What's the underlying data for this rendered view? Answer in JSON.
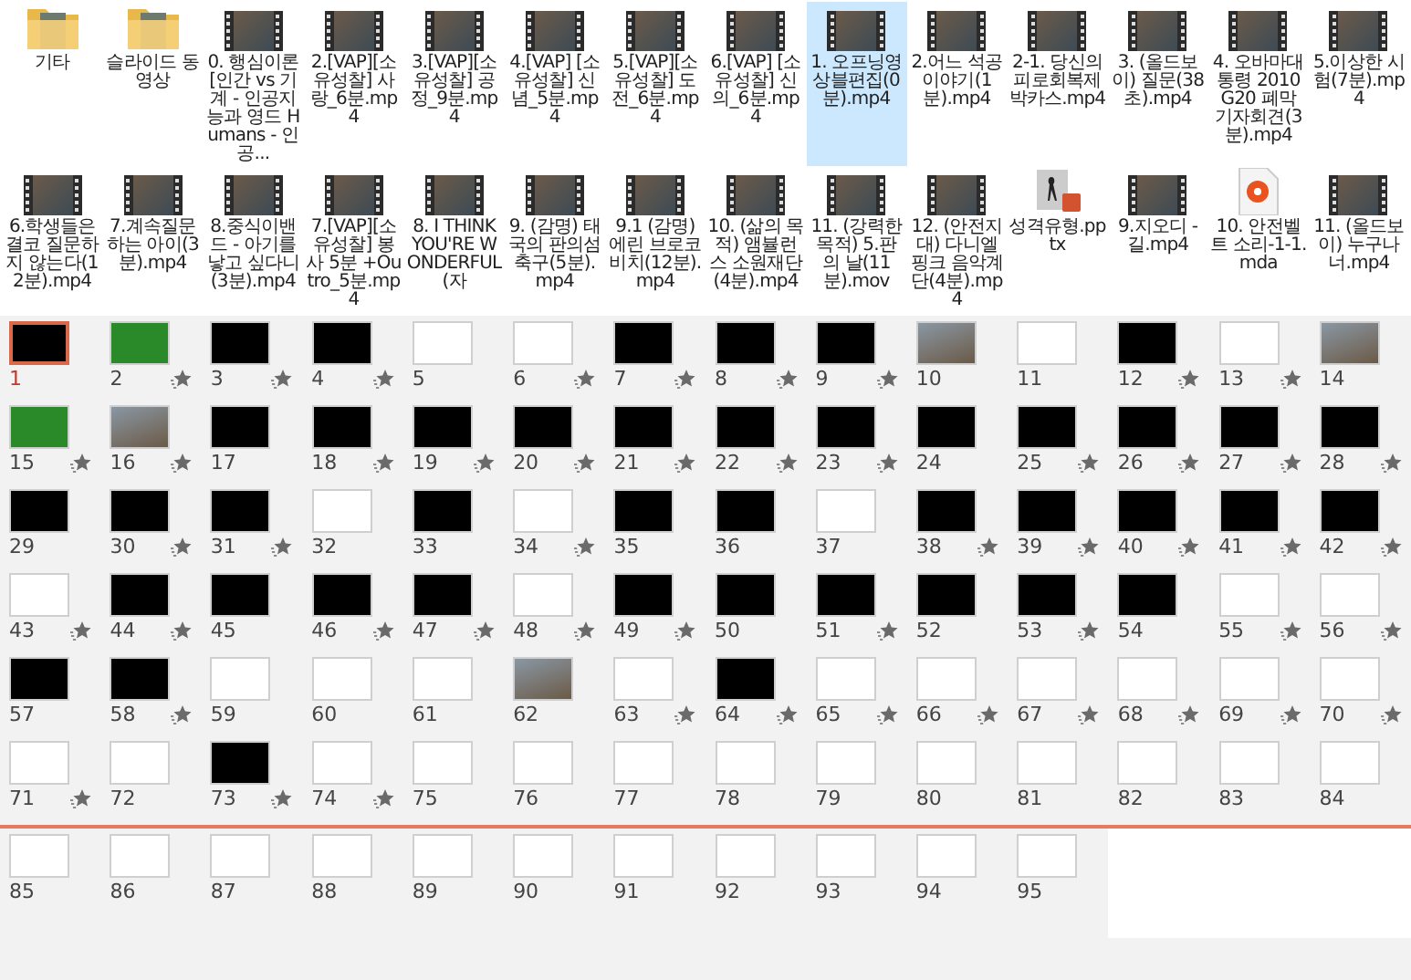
{
  "files": [
    {
      "kind": "folder",
      "label": "기타",
      "selected": false
    },
    {
      "kind": "folder",
      "label": "슬라이드 동영상",
      "selected": false
    },
    {
      "kind": "video",
      "label": "0. 행심이론 [인간 vs 기계 - 인공지능과 영드 Humans - 인공...",
      "selected": false
    },
    {
      "kind": "video",
      "label": "2.[VAP][소유성찰] 사랑_6분.mp4",
      "selected": false
    },
    {
      "kind": "video",
      "label": "3.[VAP][소유성찰] 공정_9분.mp4",
      "selected": false
    },
    {
      "kind": "video",
      "label": "4.[VAP] [소유성찰] 신념_5분.mp4",
      "selected": false
    },
    {
      "kind": "video",
      "label": "5.[VAP][소유성찰] 도전_6분.mp4",
      "selected": false
    },
    {
      "kind": "video",
      "label": "6.[VAP] [소유성찰] 신의_6분.mp4",
      "selected": false
    },
    {
      "kind": "video",
      "label": "1. 오프닝영상블편집(0분).mp4",
      "selected": true
    },
    {
      "kind": "video",
      "label": "2.어느 석공 이야기(1분).mp4",
      "selected": false
    },
    {
      "kind": "video",
      "label": "2-1. 당신의 피로회복제 박카스.mp4",
      "selected": false
    },
    {
      "kind": "video",
      "label": "3. (올드보이) 질문(38초).mp4",
      "selected": false
    },
    {
      "kind": "video",
      "label": "4. 오바마대통령 2010 G20 폐막 기자회견(3분).mp4",
      "selected": false
    },
    {
      "kind": "video",
      "label": "5.이상한 시험(7분).mp4",
      "selected": false
    },
    {
      "kind": "video",
      "label": "6.학생들은 결코 질문하지 않는다(12분).mp4",
      "selected": false
    },
    {
      "kind": "video",
      "label": "7.계속질문하는 아이(3분).mp4",
      "selected": false
    },
    {
      "kind": "video",
      "label": "8.중식이밴드 - 아기를 낳고 싶다니(3분).mp4",
      "selected": false
    },
    {
      "kind": "video",
      "label": "7.[VAP][소유성찰] 봉사 5분 +Outro_5분.mp4",
      "selected": false
    },
    {
      "kind": "video",
      "label": "8. I THINK YOU'RE WONDERFUL(자",
      "selected": false
    },
    {
      "kind": "video",
      "label": "9. (감명) 태국의 판의섬축구(5분).mp4",
      "selected": false
    },
    {
      "kind": "video",
      "label": "9.1 (감명)에린 브로코비치(12분).mp4",
      "selected": false
    },
    {
      "kind": "video",
      "label": "10. (삶의 목적) 앰뷸런스 소원재단(4분).mp4",
      "selected": false
    },
    {
      "kind": "video",
      "label": "11. (강력한 목적) 5.판의 날(11분).mov",
      "selected": false
    },
    {
      "kind": "video",
      "label": "12. (안전지대) 다니엘핑크 음악계단(4분).mp4",
      "selected": false
    },
    {
      "kind": "pptx",
      "label": "성격유형.pptx",
      "selected": false
    },
    {
      "kind": "video",
      "label": "9.지오디 - 길.mp4",
      "selected": false
    },
    {
      "kind": "audio",
      "label": "10. 안전벨트 소리-1-1.mda",
      "selected": false
    },
    {
      "kind": "video",
      "label": "11. (올드보이) 누구나 너.mp4",
      "selected": false
    }
  ],
  "slides": [
    {
      "number": "1",
      "kind": "dark",
      "animated": false,
      "selected": true
    },
    {
      "number": "2",
      "kind": "green",
      "animated": true,
      "selected": false
    },
    {
      "number": "3",
      "kind": "dark",
      "animated": true,
      "selected": false
    },
    {
      "number": "4",
      "kind": "dark",
      "animated": true,
      "selected": false
    },
    {
      "number": "5",
      "kind": "light",
      "animated": false,
      "selected": false
    },
    {
      "number": "6",
      "kind": "light",
      "animated": true,
      "selected": false
    },
    {
      "number": "7",
      "kind": "dark",
      "animated": true,
      "selected": false
    },
    {
      "number": "8",
      "kind": "dark",
      "animated": true,
      "selected": false
    },
    {
      "number": "9",
      "kind": "dark",
      "animated": true,
      "selected": false
    },
    {
      "number": "10",
      "kind": "photo",
      "animated": false,
      "selected": false
    },
    {
      "number": "11",
      "kind": "light",
      "animated": false,
      "selected": false
    },
    {
      "number": "12",
      "kind": "dark",
      "animated": true,
      "selected": false
    },
    {
      "number": "13",
      "kind": "light",
      "animated": true,
      "selected": false
    },
    {
      "number": "14",
      "kind": "photo",
      "animated": false,
      "selected": false
    },
    {
      "number": "15",
      "kind": "green",
      "animated": true,
      "selected": false
    },
    {
      "number": "16",
      "kind": "photo",
      "animated": true,
      "selected": false
    },
    {
      "number": "17",
      "kind": "dark",
      "animated": false,
      "selected": false
    },
    {
      "number": "18",
      "kind": "dark",
      "animated": true,
      "selected": false
    },
    {
      "number": "19",
      "kind": "dark",
      "animated": true,
      "selected": false
    },
    {
      "number": "20",
      "kind": "dark",
      "animated": true,
      "selected": false
    },
    {
      "number": "21",
      "kind": "dark",
      "animated": true,
      "selected": false
    },
    {
      "number": "22",
      "kind": "dark",
      "animated": true,
      "selected": false
    },
    {
      "number": "23",
      "kind": "dark",
      "animated": true,
      "selected": false
    },
    {
      "number": "24",
      "kind": "dark",
      "animated": false,
      "selected": false
    },
    {
      "number": "25",
      "kind": "dark",
      "animated": true,
      "selected": false
    },
    {
      "number": "26",
      "kind": "dark",
      "animated": true,
      "selected": false
    },
    {
      "number": "27",
      "kind": "dark",
      "animated": true,
      "selected": false
    },
    {
      "number": "28",
      "kind": "dark",
      "animated": true,
      "selected": false
    },
    {
      "number": "29",
      "kind": "dark",
      "animated": false,
      "selected": false
    },
    {
      "number": "30",
      "kind": "dark",
      "animated": true,
      "selected": false
    },
    {
      "number": "31",
      "kind": "dark",
      "animated": true,
      "selected": false
    },
    {
      "number": "32",
      "kind": "light",
      "animated": false,
      "selected": false
    },
    {
      "number": "33",
      "kind": "dark",
      "animated": false,
      "selected": false
    },
    {
      "number": "34",
      "kind": "light",
      "animated": true,
      "selected": false
    },
    {
      "number": "35",
      "kind": "dark",
      "animated": false,
      "selected": false
    },
    {
      "number": "36",
      "kind": "dark",
      "animated": false,
      "selected": false
    },
    {
      "number": "37",
      "kind": "light",
      "animated": false,
      "selected": false
    },
    {
      "number": "38",
      "kind": "dark",
      "animated": true,
      "selected": false
    },
    {
      "number": "39",
      "kind": "dark",
      "animated": true,
      "selected": false
    },
    {
      "number": "40",
      "kind": "dark",
      "animated": true,
      "selected": false
    },
    {
      "number": "41",
      "kind": "dark",
      "animated": true,
      "selected": false
    },
    {
      "number": "42",
      "kind": "dark",
      "animated": true,
      "selected": false
    },
    {
      "number": "43",
      "kind": "light",
      "animated": true,
      "selected": false
    },
    {
      "number": "44",
      "kind": "dark",
      "animated": true,
      "selected": false
    },
    {
      "number": "45",
      "kind": "dark",
      "animated": false,
      "selected": false
    },
    {
      "number": "46",
      "kind": "dark",
      "animated": true,
      "selected": false
    },
    {
      "number": "47",
      "kind": "dark",
      "animated": true,
      "selected": false
    },
    {
      "number": "48",
      "kind": "light",
      "animated": true,
      "selected": false
    },
    {
      "number": "49",
      "kind": "dark",
      "animated": true,
      "selected": false
    },
    {
      "number": "50",
      "kind": "dark",
      "animated": false,
      "selected": false
    },
    {
      "number": "51",
      "kind": "dark",
      "animated": true,
      "selected": false
    },
    {
      "number": "52",
      "kind": "dark",
      "animated": false,
      "selected": false
    },
    {
      "number": "53",
      "kind": "dark",
      "animated": true,
      "selected": false
    },
    {
      "number": "54",
      "kind": "dark",
      "animated": false,
      "selected": false
    },
    {
      "number": "55",
      "kind": "light",
      "animated": true,
      "selected": false
    },
    {
      "number": "56",
      "kind": "light",
      "animated": true,
      "selected": false
    },
    {
      "number": "57",
      "kind": "dark",
      "animated": false,
      "selected": false
    },
    {
      "number": "58",
      "kind": "dark",
      "animated": true,
      "selected": false
    },
    {
      "number": "59",
      "kind": "light",
      "animated": false,
      "selected": false
    },
    {
      "number": "60",
      "kind": "light",
      "animated": false,
      "selected": false
    },
    {
      "number": "61",
      "kind": "light",
      "animated": false,
      "selected": false
    },
    {
      "number": "62",
      "kind": "photo",
      "animated": false,
      "selected": false
    },
    {
      "number": "63",
      "kind": "light",
      "animated": true,
      "selected": false
    },
    {
      "number": "64",
      "kind": "dark",
      "animated": true,
      "selected": false
    },
    {
      "number": "65",
      "kind": "light",
      "animated": true,
      "selected": false
    },
    {
      "number": "66",
      "kind": "light",
      "animated": true,
      "selected": false
    },
    {
      "number": "67",
      "kind": "light",
      "animated": true,
      "selected": false
    },
    {
      "number": "68",
      "kind": "light",
      "animated": true,
      "selected": false
    },
    {
      "number": "69",
      "kind": "light",
      "animated": true,
      "selected": false
    },
    {
      "number": "70",
      "kind": "light",
      "animated": true,
      "selected": false
    },
    {
      "number": "71",
      "kind": "light",
      "animated": true,
      "selected": false
    },
    {
      "number": "72",
      "kind": "light",
      "animated": false,
      "selected": false
    },
    {
      "number": "73",
      "kind": "dark",
      "animated": true,
      "selected": false
    },
    {
      "number": "74",
      "kind": "light",
      "animated": true,
      "selected": false
    },
    {
      "number": "75",
      "kind": "light",
      "animated": false,
      "selected": false
    },
    {
      "number": "76",
      "kind": "light",
      "animated": false,
      "selected": false
    },
    {
      "number": "77",
      "kind": "light",
      "animated": false,
      "selected": false
    },
    {
      "number": "78",
      "kind": "light",
      "animated": false,
      "selected": false
    },
    {
      "number": "79",
      "kind": "light",
      "animated": false,
      "selected": false
    },
    {
      "number": "80",
      "kind": "light",
      "animated": false,
      "selected": false
    },
    {
      "number": "81",
      "kind": "light",
      "animated": false,
      "selected": false
    },
    {
      "number": "82",
      "kind": "light",
      "animated": false,
      "selected": false
    },
    {
      "number": "83",
      "kind": "light",
      "animated": false,
      "selected": false
    },
    {
      "number": "84",
      "kind": "light",
      "animated": false,
      "selected": false
    },
    {
      "number": "85",
      "kind": "light",
      "animated": false,
      "selected": false
    },
    {
      "number": "86",
      "kind": "light",
      "animated": false,
      "selected": false
    },
    {
      "number": "87",
      "kind": "light",
      "animated": false,
      "selected": false
    },
    {
      "number": "88",
      "kind": "light",
      "animated": false,
      "selected": false
    },
    {
      "number": "89",
      "kind": "light",
      "animated": false,
      "selected": false
    },
    {
      "number": "90",
      "kind": "light",
      "animated": false,
      "selected": false
    },
    {
      "number": "91",
      "kind": "light",
      "animated": false,
      "selected": false
    },
    {
      "number": "92",
      "kind": "light",
      "animated": false,
      "selected": false
    },
    {
      "number": "93",
      "kind": "light",
      "animated": false,
      "selected": false
    },
    {
      "number": "94",
      "kind": "light",
      "animated": false,
      "selected": false
    },
    {
      "number": "95",
      "kind": "light",
      "animated": false,
      "selected": false
    }
  ]
}
